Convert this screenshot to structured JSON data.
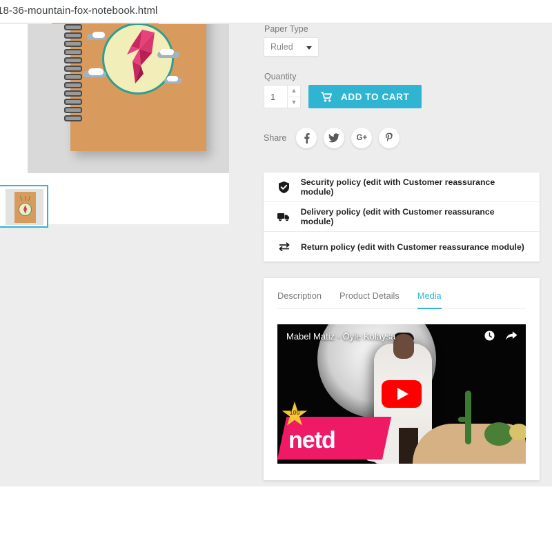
{
  "browser": {
    "url": "18-36-mountain-fox-notebook.html"
  },
  "product": {
    "image_alt": "mountain-fox-notebook",
    "thumbnail_alt": "mountain-fox-notebook-thumbnail"
  },
  "options": {
    "paper_type_label": "Paper Type",
    "paper_type_value": "Ruled",
    "quantity_label": "Quantity",
    "quantity_value": "1",
    "add_to_cart_label": "ADD TO CART",
    "cart_icon": "shopping-cart-icon",
    "stepper_up": "▲",
    "stepper_down": "▼"
  },
  "share": {
    "label": "Share",
    "buttons": [
      {
        "name": "facebook",
        "glyph": "f"
      },
      {
        "name": "twitter",
        "glyph": "t"
      },
      {
        "name": "googleplus",
        "glyph": "G+"
      },
      {
        "name": "pinterest",
        "glyph": "P"
      }
    ]
  },
  "reassurance": [
    {
      "icon": "shield-check-icon",
      "text": "Security policy (edit with Customer reassurance module)"
    },
    {
      "icon": "delivery-truck-icon",
      "text": "Delivery policy (edit with Customer reassurance module)"
    },
    {
      "icon": "return-arrows-icon",
      "text": "Return policy (edit with Customer reassurance module)"
    }
  ],
  "tabs": [
    {
      "label": "Description",
      "active": false
    },
    {
      "label": "Product Details",
      "active": false
    },
    {
      "label": "Media",
      "active": true
    }
  ],
  "video": {
    "title": "Mabel Matiz - Öyle Kolaysa",
    "watch_later_icon": "clock-icon",
    "share_icon": "share-arrow-icon",
    "play_icon": "youtube-play-icon",
    "watermark": "netd",
    "badge": "100"
  },
  "colors": {
    "accent": "#2fb5d2",
    "page_bg": "#ededed",
    "card_bg": "#ffffff",
    "youtube_red": "#ff0000",
    "netd_pink": "#ef1a66"
  }
}
